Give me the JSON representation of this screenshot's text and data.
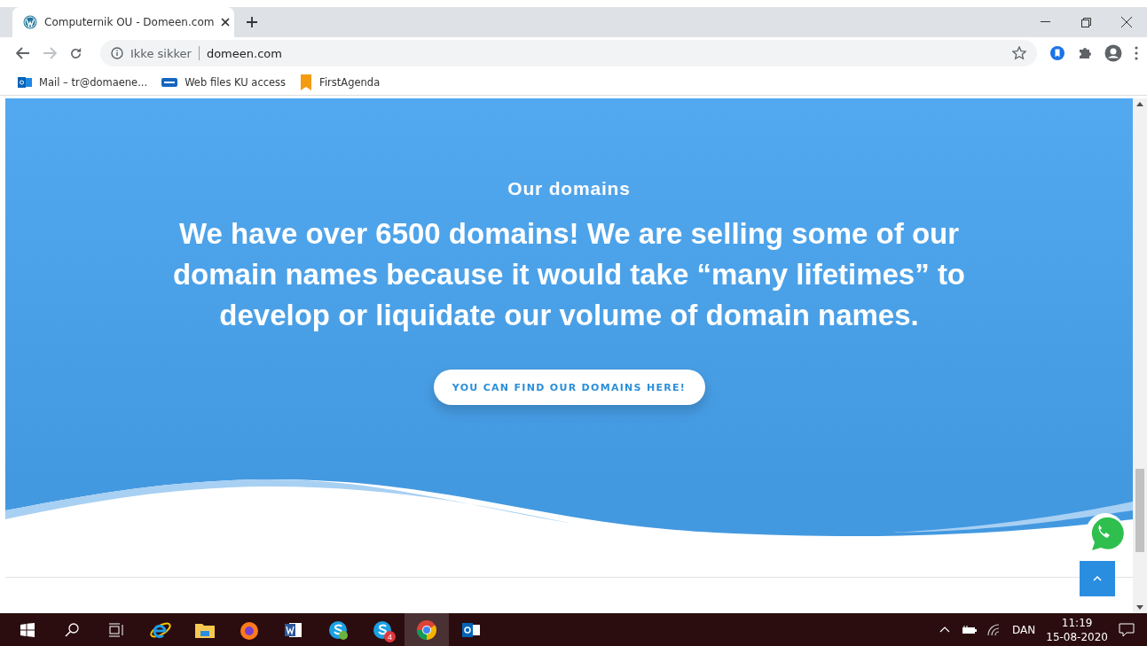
{
  "browser": {
    "tabs": [
      {
        "title": "Computernik OU - Domeen.com",
        "selected": true
      }
    ],
    "security_label": "Ikke sikker",
    "url": "domeen.com",
    "bookmarks": [
      {
        "label": "Mail – tr@domaene..."
      },
      {
        "label": "Web files KU access"
      },
      {
        "label": "FirstAgenda"
      }
    ]
  },
  "hero": {
    "eyebrow": "Our domains",
    "heading": "We have over 6500 domains! We are selling some of our domain names because it would take “many lifetimes” to develop or liquidate our volume of domain names.",
    "button": "YOU CAN FIND OUR DOMAINS HERE!"
  },
  "taskbar": {
    "apps": [
      {
        "kind": "ie",
        "selected": false
      },
      {
        "kind": "folder",
        "selected": false
      },
      {
        "kind": "firefox",
        "selected": false
      },
      {
        "kind": "word",
        "selected": false
      },
      {
        "kind": "skype",
        "selected": false
      },
      {
        "kind": "skype-badge",
        "selected": false,
        "badge": "4"
      },
      {
        "kind": "chrome",
        "selected": true
      },
      {
        "kind": "outlook",
        "selected": false
      }
    ],
    "language": "DAN",
    "time": "11:19",
    "date": "15-08-2020"
  }
}
